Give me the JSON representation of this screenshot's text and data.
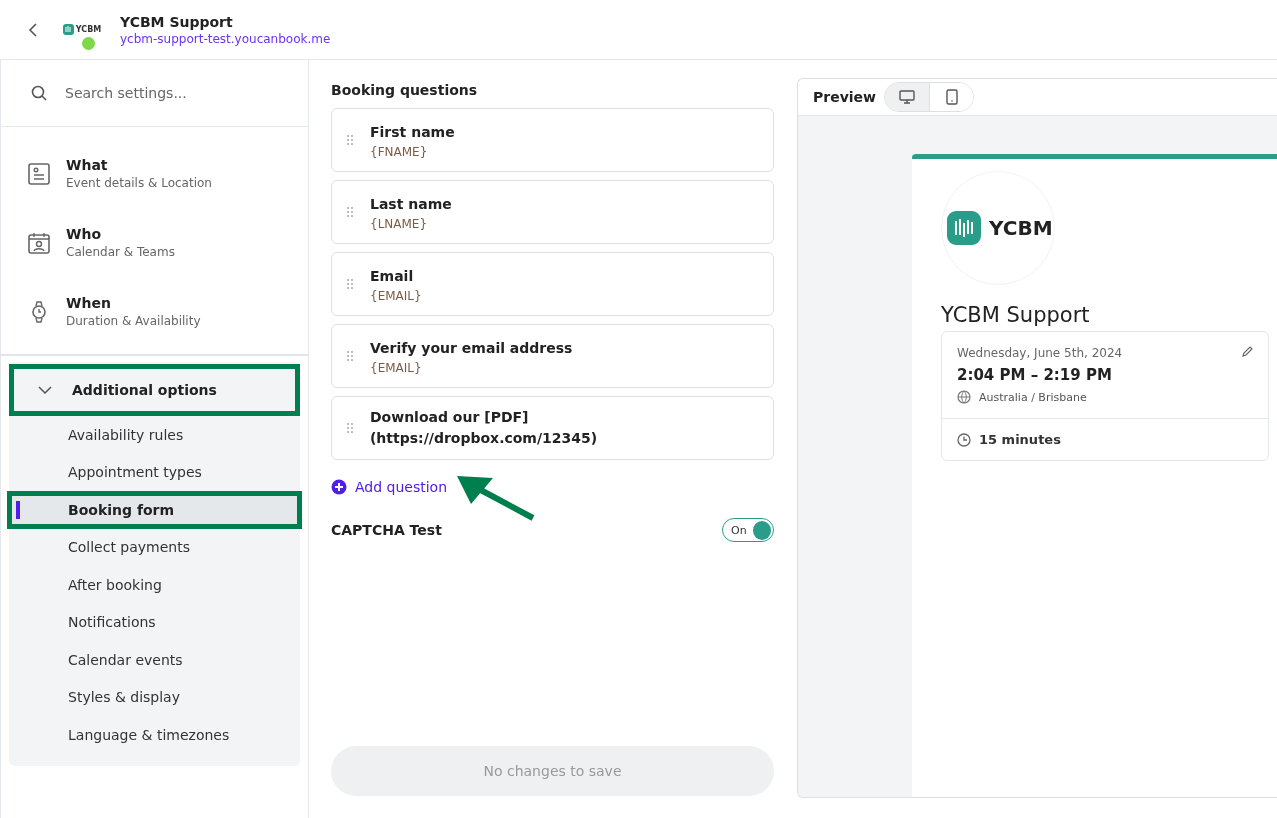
{
  "header": {
    "logo_text": "YCBM",
    "title": "YCBM Support",
    "url": "ycbm-support-test.youcanbook.me",
    "online": true
  },
  "sidebar": {
    "search": {
      "placeholder": "Search settings..."
    },
    "sections": [
      {
        "title": "What",
        "subtitle": "Event details & Location"
      },
      {
        "title": "Who",
        "subtitle": "Calendar & Teams"
      },
      {
        "title": "When",
        "subtitle": "Duration & Availability"
      }
    ],
    "group": {
      "title": "Additional options",
      "expanded": true,
      "annotated": true,
      "items": [
        {
          "label": "Availability rules",
          "selected": false,
          "annotated": false
        },
        {
          "label": "Appointment types",
          "selected": false,
          "annotated": false
        },
        {
          "label": "Booking form",
          "selected": true,
          "annotated": true
        },
        {
          "label": "Collect payments",
          "selected": false,
          "annotated": false
        },
        {
          "label": "After booking",
          "selected": false,
          "annotated": false
        },
        {
          "label": "Notifications",
          "selected": false,
          "annotated": false
        },
        {
          "label": "Calendar events",
          "selected": false,
          "annotated": false
        },
        {
          "label": "Styles & display",
          "selected": false,
          "annotated": false
        },
        {
          "label": "Language & timezones",
          "selected": false,
          "annotated": false
        }
      ]
    }
  },
  "form": {
    "heading": "Booking questions",
    "questions": [
      {
        "label": "First name",
        "token": "{FNAME}"
      },
      {
        "label": "Last name",
        "token": "{LNAME}"
      },
      {
        "label": "Email",
        "token": "{EMAIL}"
      },
      {
        "label": "Verify your email address",
        "token": "{EMAIL}"
      },
      {
        "label": "Download our [PDF] (https://dropbox.com/12345)"
      }
    ],
    "add_question": "Add question",
    "captcha": {
      "label": "CAPTCHA Test",
      "on": true,
      "state_text": "On"
    },
    "save": {
      "label": "No changes to save",
      "disabled": true
    }
  },
  "preview": {
    "title": "Preview",
    "devices": [
      {
        "selected": true
      },
      {
        "selected": false
      }
    ],
    "logo_text": "YCBM",
    "event_title": "YCBM Support",
    "date": "Wednesday, June 5th, 2024",
    "time": "2:04 PM – 2:19 PM",
    "timezone": "Australia / Brisbane",
    "duration": "15 minutes"
  }
}
